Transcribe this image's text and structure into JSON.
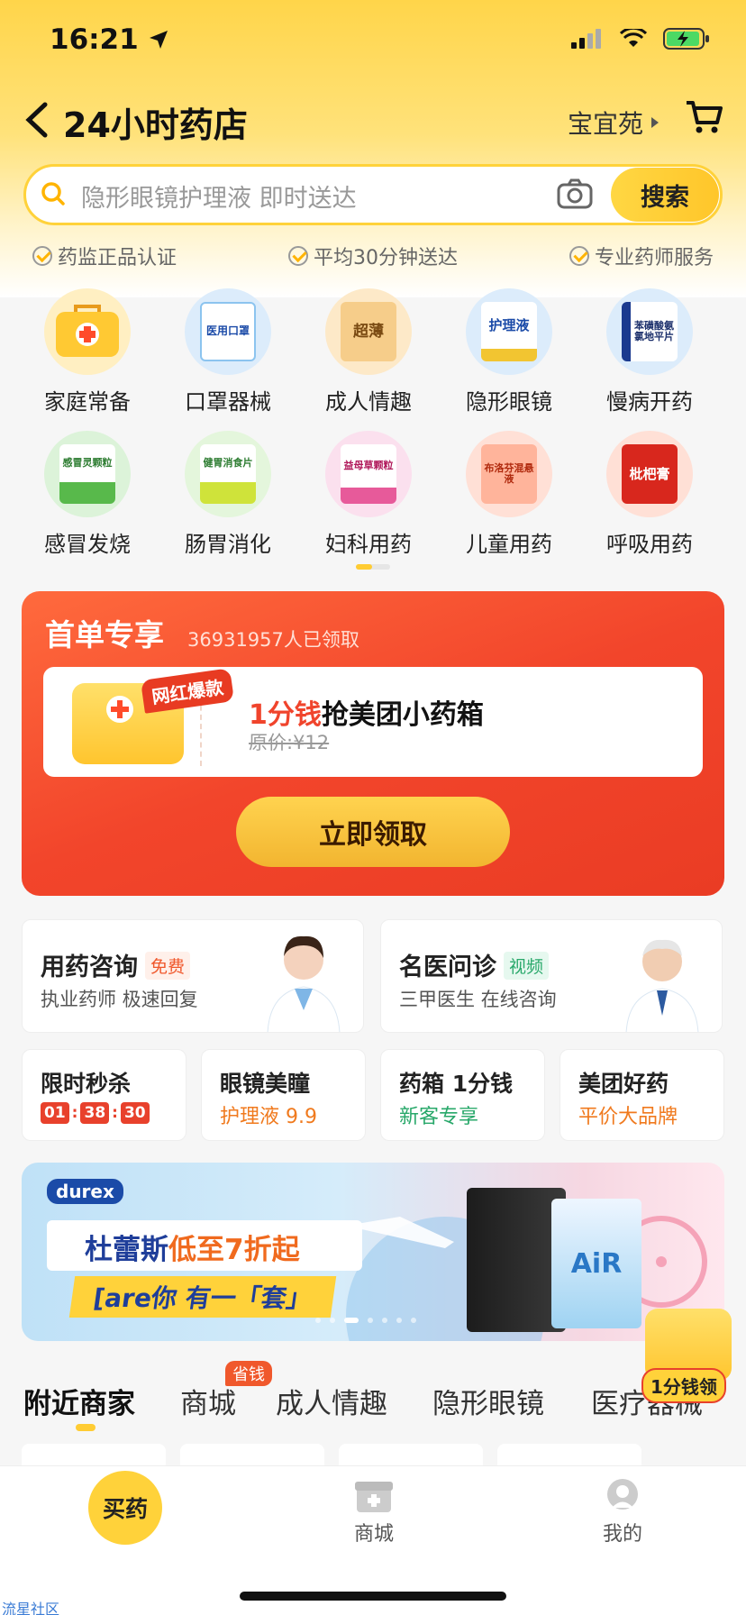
{
  "status": {
    "time": "16:21"
  },
  "header": {
    "title": "24小时药店",
    "location": "宝宜苑"
  },
  "search": {
    "placeholder": "隐形眼镜护理液 即时送达",
    "button": "搜索"
  },
  "assurances": [
    "药监正品认证",
    "平均30分钟送达",
    "专业药师服务"
  ],
  "categories": [
    {
      "label": "家庭常备",
      "icon": "first-aid-kit-icon",
      "art": ""
    },
    {
      "label": "口罩器械",
      "icon": "mask-box-icon",
      "art": "医用口罩"
    },
    {
      "label": "成人情趣",
      "icon": "condom-box-icon",
      "art": "超薄"
    },
    {
      "label": "隐形眼镜",
      "icon": "contact-solution-icon",
      "art": "护理液"
    },
    {
      "label": "慢病开药",
      "icon": "pill-box-icon",
      "art": "苯磺酸氨氯地平片"
    },
    {
      "label": "感冒发烧",
      "icon": "cold-granules-icon",
      "art": "感冒灵颗粒"
    },
    {
      "label": "肠胃消化",
      "icon": "digestive-tablets-icon",
      "art": "健胃消食片"
    },
    {
      "label": "妇科用药",
      "icon": "motherwort-granules-icon",
      "art": "益母草颗粒"
    },
    {
      "label": "儿童用药",
      "icon": "child-medicine-icon",
      "art": "布洛芬混悬液"
    },
    {
      "label": "呼吸用药",
      "icon": "loquat-syrup-icon",
      "art": "枇杷膏"
    }
  ],
  "promo": {
    "title": "首单专享",
    "count": "36931957人已领取",
    "badge": "网红爆款",
    "price_red": "1分钱",
    "product": "抢美团小药箱",
    "original": "原价:¥12",
    "button": "立即领取"
  },
  "services": [
    {
      "title": "用药咨询",
      "tag": "免费",
      "sub": "执业药师 极速回复"
    },
    {
      "title": "名医问诊",
      "tag": "视频",
      "sub": "三甲医生 在线咨询"
    }
  ],
  "mini_cards": [
    {
      "title": "限时秒杀",
      "countdown": [
        "01",
        "38",
        "30"
      ]
    },
    {
      "title": "眼镜美瞳",
      "sub": "护理液 9.9"
    },
    {
      "title": "药箱 1分钱",
      "sub": "新客专享"
    },
    {
      "title": "美团好药",
      "sub": "平价大品牌"
    }
  ],
  "banner": {
    "brand": "durex",
    "line1a": "杜蕾斯",
    "line1b": "低至7折起",
    "line2": "[are你 有一「套」",
    "product": "AiR"
  },
  "floating": {
    "label": "1分钱领"
  },
  "tabs": [
    "附近商家",
    "商城",
    "成人情趣",
    "隐形眼镜",
    "医疗器械"
  ],
  "tab_badge": "省钱",
  "bottom_nav": {
    "buy": "买药",
    "mall": "商城",
    "me": "我的"
  },
  "watermark": "流星社区",
  "colors": {
    "accent": "#ffd23a",
    "promo_red": "#f0442c"
  }
}
